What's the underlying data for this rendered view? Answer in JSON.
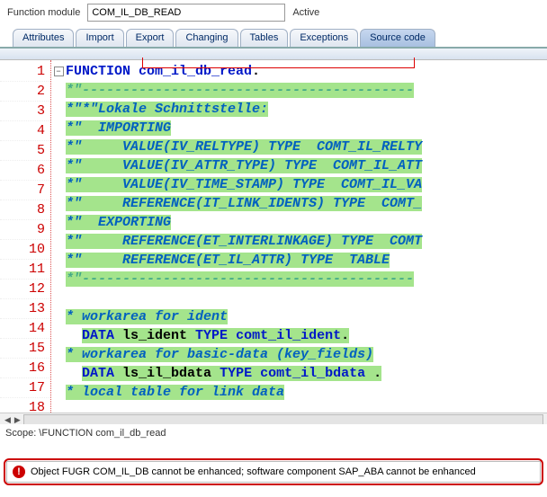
{
  "header": {
    "label": "Function module",
    "value": "COM_IL_DB_READ",
    "status": "Active"
  },
  "tabs": {
    "items": [
      {
        "label": "Attributes"
      },
      {
        "label": "Import"
      },
      {
        "label": "Export"
      },
      {
        "label": "Changing"
      },
      {
        "label": "Tables"
      },
      {
        "label": "Exceptions"
      },
      {
        "label": "Source code"
      }
    ],
    "selected_index": 6
  },
  "editor": {
    "lines": [
      {
        "n": 1,
        "fold": "minus",
        "segments": [
          {
            "t": "FUNCTION ",
            "cls": "kw"
          },
          {
            "t": "com_il_db_read",
            "cls": "kw"
          },
          {
            "t": ".",
            "cls": "punct"
          }
        ]
      },
      {
        "n": 2,
        "fold": "line",
        "segments": [
          {
            "t": "*\"-----------------------------------------",
            "cls": "cm hl"
          }
        ]
      },
      {
        "n": 3,
        "fold": "line",
        "segments": [
          {
            "t": "*\"*\"Lokale Schnittstelle:",
            "cls": "cm2 hl"
          }
        ]
      },
      {
        "n": 4,
        "fold": "line",
        "segments": [
          {
            "t": "*\"  IMPORTING",
            "cls": "cm2 hl"
          }
        ]
      },
      {
        "n": 5,
        "fold": "line",
        "segments": [
          {
            "t": "*\"     VALUE(IV_RELTYPE) TYPE  COMT_IL_RELTY",
            "cls": "cm2 hl"
          }
        ]
      },
      {
        "n": 6,
        "fold": "line",
        "segments": [
          {
            "t": "*\"     VALUE(IV_ATTR_TYPE) TYPE  COMT_IL_ATT",
            "cls": "cm2 hl"
          }
        ]
      },
      {
        "n": 7,
        "fold": "line",
        "segments": [
          {
            "t": "*\"     VALUE(IV_TIME_STAMP) TYPE  COMT_IL_VA",
            "cls": "cm2 hl"
          }
        ]
      },
      {
        "n": 8,
        "fold": "line",
        "segments": [
          {
            "t": "*\"     REFERENCE(IT_LINK_IDENTS) TYPE  COMT_",
            "cls": "cm2 hl"
          }
        ]
      },
      {
        "n": 9,
        "fold": "line",
        "segments": [
          {
            "t": "*\"  EXPORTING",
            "cls": "cm2 hl"
          }
        ]
      },
      {
        "n": 10,
        "fold": "line",
        "segments": [
          {
            "t": "*\"     REFERENCE(ET_INTERLINKAGE) TYPE  COMT",
            "cls": "cm2 hl"
          }
        ]
      },
      {
        "n": 11,
        "fold": "line",
        "segments": [
          {
            "t": "*\"     REFERENCE(ET_IL_ATTR) TYPE  TABLE",
            "cls": "cm2 hl"
          }
        ]
      },
      {
        "n": 12,
        "fold": "line",
        "segments": [
          {
            "t": "*\"-----------------------------------------",
            "cls": "cm hl"
          }
        ]
      },
      {
        "n": 13,
        "fold": "line",
        "segments": [
          {
            "t": " ",
            "cls": ""
          }
        ]
      },
      {
        "n": 14,
        "fold": "line",
        "segments": [
          {
            "t": "* workarea for ident",
            "cls": "cm2 hl"
          }
        ]
      },
      {
        "n": 15,
        "fold": "line",
        "segments": [
          {
            "t": "  ",
            "cls": ""
          },
          {
            "t": "DATA ",
            "cls": "kw hl"
          },
          {
            "t": "ls_ident ",
            "cls": "ident hl"
          },
          {
            "t": "TYPE ",
            "cls": "kw hl"
          },
          {
            "t": "comt_il_ident",
            "cls": "kw hl"
          },
          {
            "t": ".",
            "cls": "punct hl"
          }
        ]
      },
      {
        "n": 16,
        "fold": "line",
        "segments": [
          {
            "t": "* workarea for basic-data (key_fields)",
            "cls": "cm2 hl"
          }
        ]
      },
      {
        "n": 17,
        "fold": "line",
        "segments": [
          {
            "t": "  ",
            "cls": ""
          },
          {
            "t": "DATA ",
            "cls": "kw hl"
          },
          {
            "t": "ls_il_bdata ",
            "cls": "ident hl"
          },
          {
            "t": "TYPE ",
            "cls": "kw hl"
          },
          {
            "t": "comt_il_bdata ",
            "cls": "kw hl"
          },
          {
            "t": ".",
            "cls": "punct hl"
          }
        ]
      },
      {
        "n": 18,
        "fold": "line",
        "segments": [
          {
            "t": "* local table for link data",
            "cls": "cm2 hl"
          }
        ]
      }
    ]
  },
  "scope": "Scope: \\FUNCTION com_il_db_read",
  "error": {
    "message": "Object FUGR COM_IL_DB cannot be enhanced; software component SAP_ABA cannot be enhanced"
  }
}
